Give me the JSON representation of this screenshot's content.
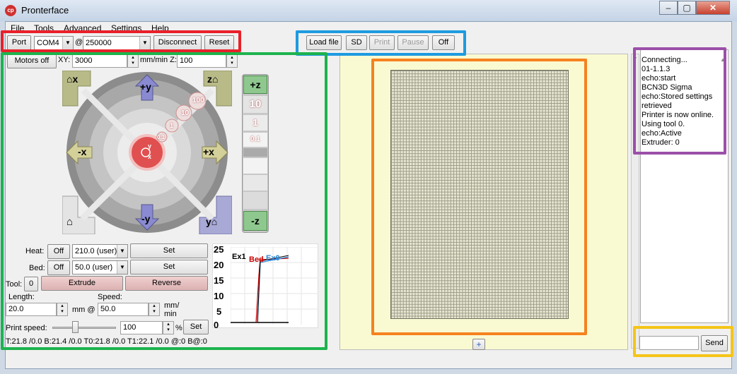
{
  "window": {
    "title": "Pronterface",
    "minimize": "–",
    "maximize": "▢",
    "close": "✕"
  },
  "menu": [
    "File",
    "Tools",
    "Advanced",
    "Settings",
    "Help"
  ],
  "connection": {
    "port_label": "Port",
    "port": "COM4",
    "at": "@",
    "baud": "250000",
    "disconnect": "Disconnect",
    "reset": "Reset"
  },
  "filebar": {
    "load": "Load file",
    "sd": "SD",
    "print": "Print",
    "pause": "Pause",
    "off": "Off"
  },
  "motion": {
    "motors_off": "Motors off",
    "xy_label": "XY:",
    "xy_value": "3000",
    "xy_unit": "mm/min Z:",
    "z_value": "100"
  },
  "jog": {
    "home_x": "x",
    "home_z": "z",
    "plus_y": "+y",
    "minus_y": "-y",
    "minus_x": "-x",
    "plus_x": "+x",
    "plus_z": "+z",
    "minus_z": "-z",
    "steps": [
      "100",
      "10",
      "1",
      "0.1"
    ],
    "center_y": "y",
    "center_x": "x"
  },
  "heat": {
    "heat_label": "Heat:",
    "heat_off": "Off",
    "heat_value": "210.0 (user)",
    "set": "Set",
    "bed_label": "Bed:",
    "bed_off": "Off",
    "bed_value": "50.0 (user)"
  },
  "tool": {
    "label": "Tool:",
    "value": "0",
    "extrude": "Extrude",
    "reverse": "Reverse"
  },
  "extrusion": {
    "length_label": "Length:",
    "length": "20.0",
    "mm_at": "mm @",
    "speed_label": "Speed:",
    "speed": "50.0",
    "unit1": "mm/",
    "unit2": "min"
  },
  "printspeed": {
    "label": "Print speed:",
    "value": "100",
    "pct": "%",
    "set": "Set"
  },
  "status": "T:21.8 /0.0 B:21.4 /0.0 T0:21.8 /0.0 T1:22.1 /0.0 @:0 B@:0",
  "graph": {
    "yticks": [
      "25",
      "20",
      "15",
      "10",
      "5",
      "0"
    ],
    "ex1": "Ex1",
    "bed": "Bed",
    "ex0": "Ex0",
    "colors": {
      "ex1": "#000000",
      "bed": "#cc0000",
      "ex0": "#2a8adb"
    }
  },
  "log": [
    "Connecting...",
    "01-1.1.3",
    "echo:start",
    "BCN3D Sigma",
    "echo:Stored settings",
    "retrieved",
    "Printer is now online.",
    "Using tool 0.",
    "echo:Active",
    "Extruder: 0"
  ],
  "send": {
    "label": "Send",
    "placeholder": ""
  },
  "plate": {
    "plus": "+"
  },
  "highlight_colors": {
    "connection": "#e8202a",
    "files": "#1e9be0",
    "controls": "#1db34d",
    "plate": "#f58220",
    "log": "#9b4fa8",
    "send": "#f5c518"
  }
}
